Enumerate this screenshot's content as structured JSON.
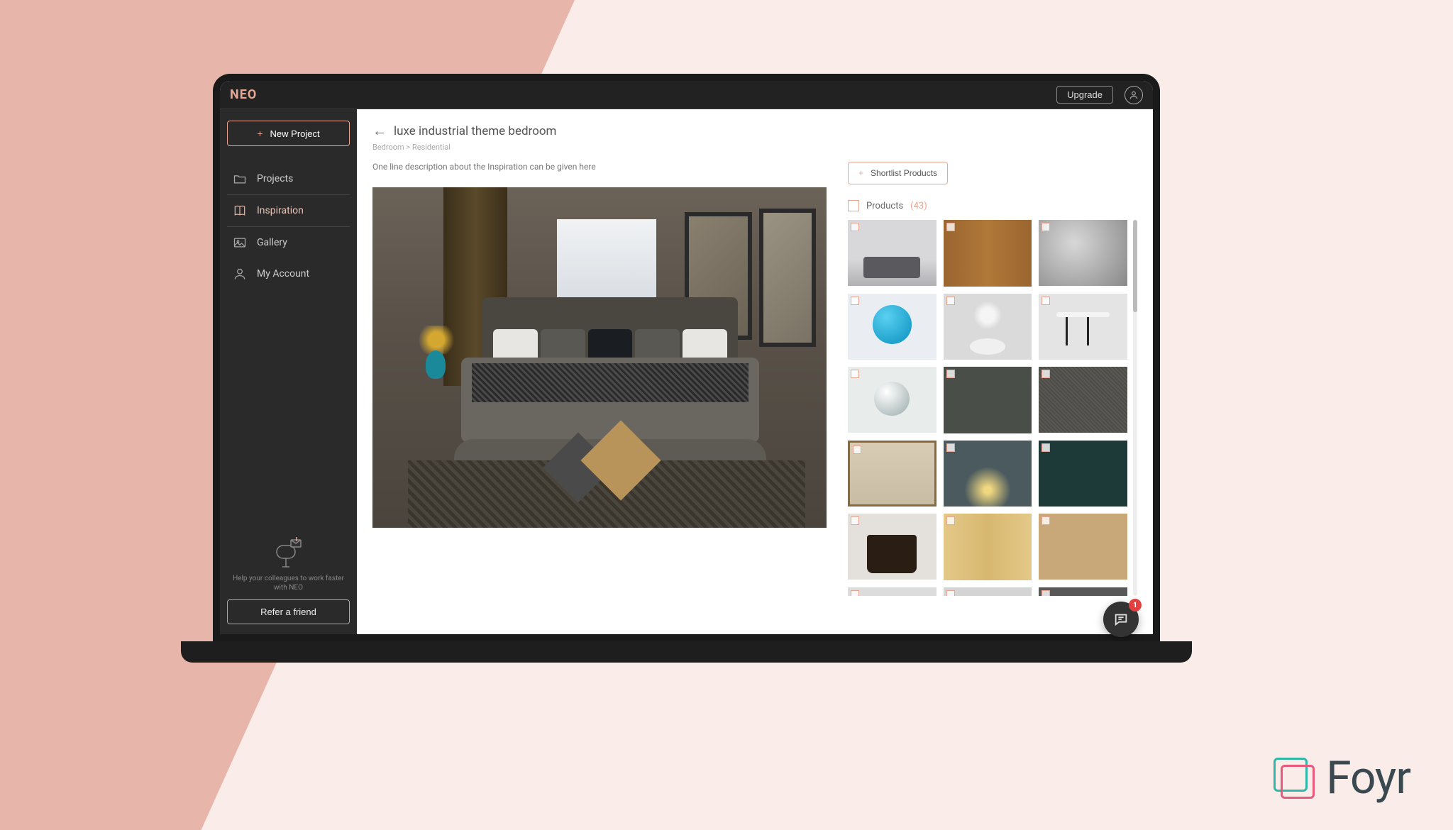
{
  "brand": "NEO",
  "topbar": {
    "upgrade": "Upgrade"
  },
  "sidebar": {
    "new_project": "New Project",
    "items": [
      {
        "label": "Projects"
      },
      {
        "label": "Inspiration"
      },
      {
        "label": "Gallery"
      },
      {
        "label": "My Account"
      }
    ],
    "help_text": "Help your colleagues to work faster with NEO",
    "refer": "Refer a friend"
  },
  "page": {
    "title": "luxe industrial theme bedroom",
    "breadcrumb": "Bedroom > Residential",
    "description": "One line description about the Inspiration can be given here"
  },
  "shortlist": {
    "label": "Shortlist Products"
  },
  "products": {
    "label": "Products",
    "count": "(43)"
  },
  "chat": {
    "badge": "1"
  },
  "logo": {
    "text": "Foyr"
  }
}
